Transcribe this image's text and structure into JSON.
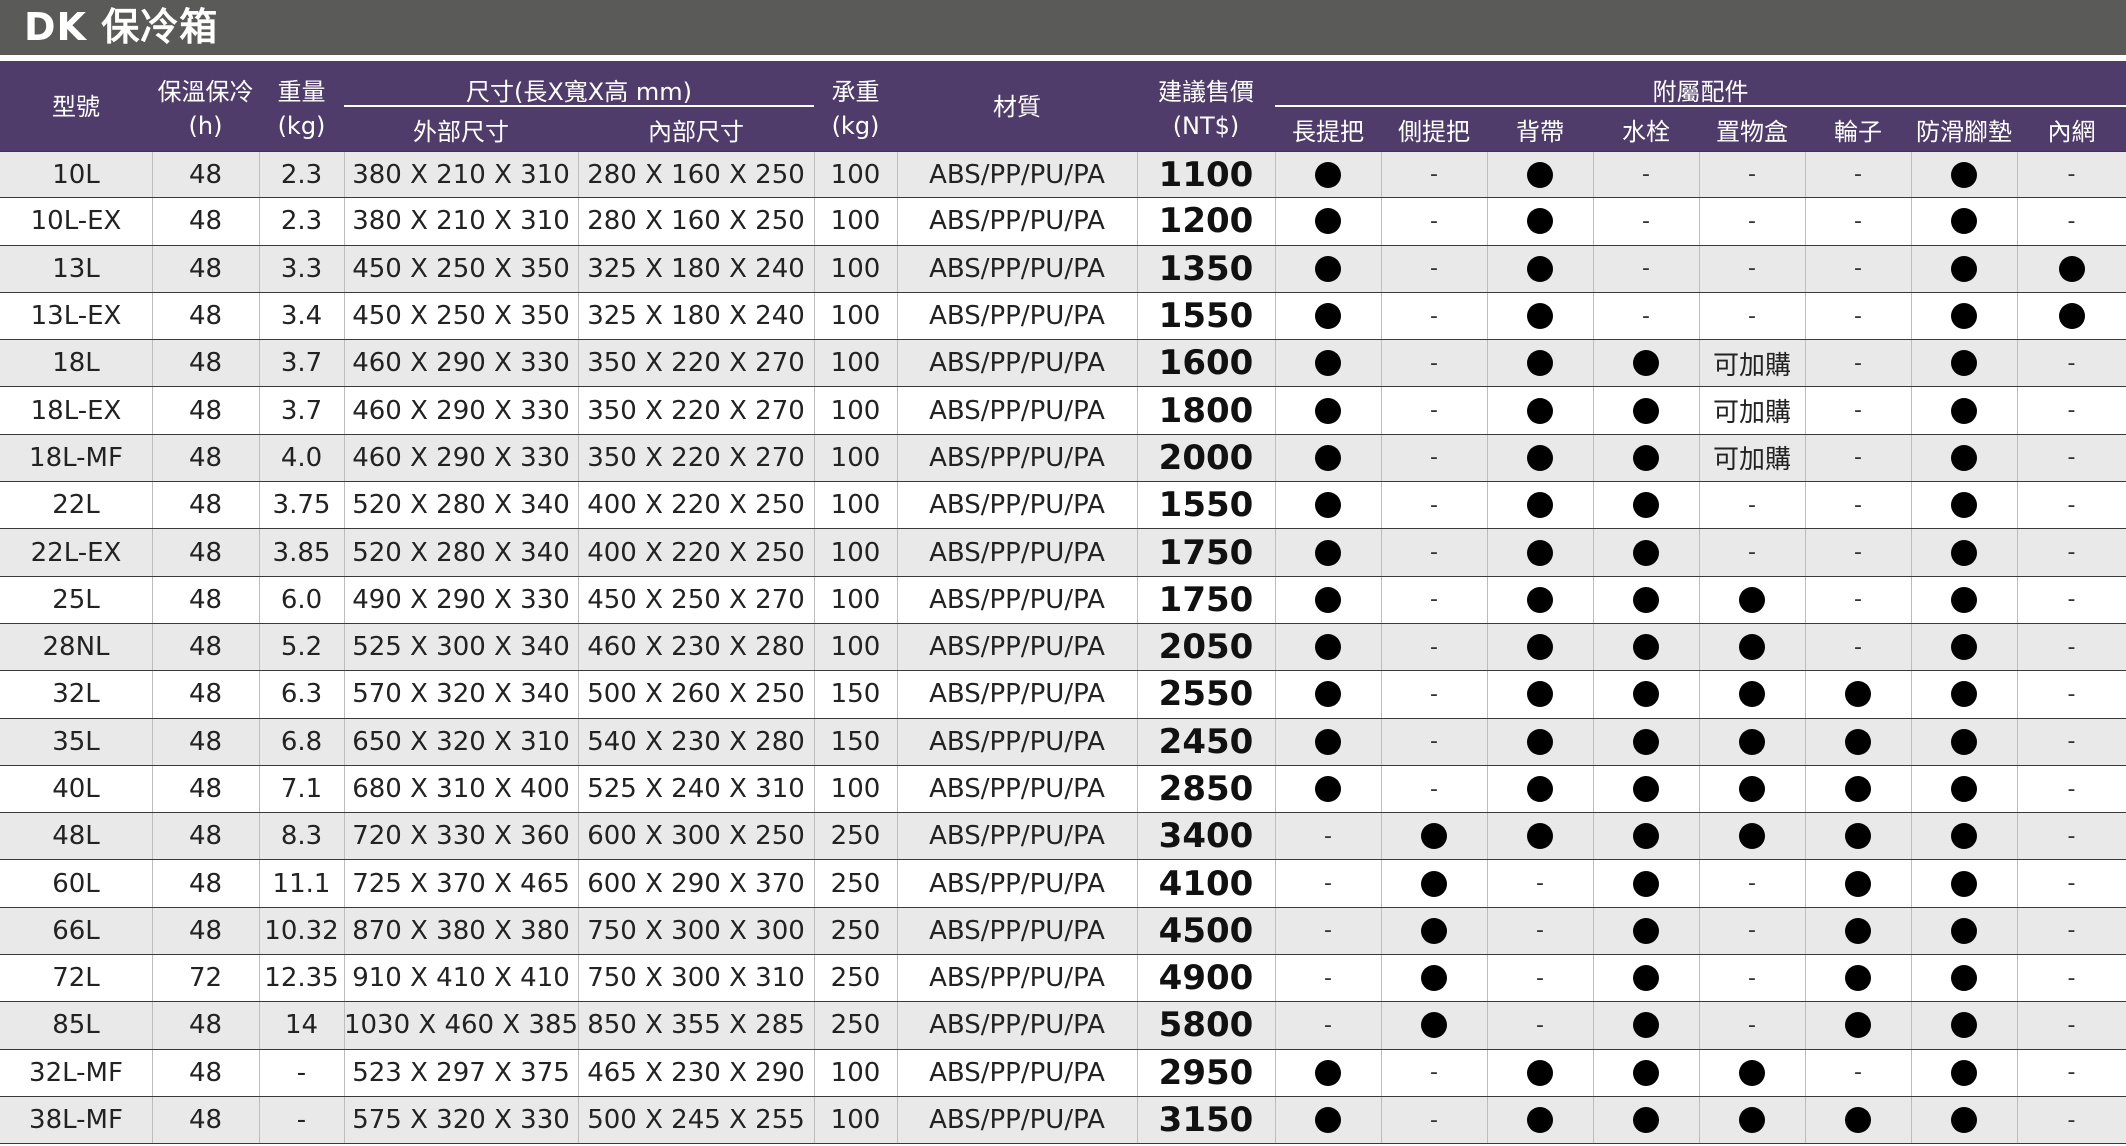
{
  "title": "DK 保冷箱",
  "header": {
    "model": "型號",
    "insulation": [
      "保溫保冷",
      "(h)"
    ],
    "weight": [
      "重量",
      "(kg)"
    ],
    "dims": "尺寸(長X寬X高 mm)",
    "outer": "外部尺寸",
    "inner": "內部尺寸",
    "load": [
      "承重",
      "(kg)"
    ],
    "material": "材質",
    "price": [
      "建議售價",
      "(NT$)"
    ],
    "accessories": "附屬配件",
    "acc_cols": [
      "長提把",
      "側提把",
      "背帶",
      "水栓",
      "置物盒",
      "輪子",
      "防滑腳墊",
      "內網"
    ]
  },
  "rows": [
    {
      "model": "10L",
      "hours": "48",
      "weight": "2.3",
      "outer": "380 X 210 X 310",
      "inner": "280 X 160 X 250",
      "load": "100",
      "material": "ABS/PP/PU/PA",
      "price": "1100",
      "acc": [
        "●",
        "-",
        "●",
        "-",
        "-",
        "-",
        "●",
        "-"
      ]
    },
    {
      "model": "10L-EX",
      "hours": "48",
      "weight": "2.3",
      "outer": "380 X 210 X 310",
      "inner": "280 X 160 X 250",
      "load": "100",
      "material": "ABS/PP/PU/PA",
      "price": "1200",
      "acc": [
        "●",
        "-",
        "●",
        "-",
        "-",
        "-",
        "●",
        "-"
      ]
    },
    {
      "model": "13L",
      "hours": "48",
      "weight": "3.3",
      "outer": "450 X 250 X 350",
      "inner": "325 X 180 X 240",
      "load": "100",
      "material": "ABS/PP/PU/PA",
      "price": "1350",
      "acc": [
        "●",
        "-",
        "●",
        "-",
        "-",
        "-",
        "●",
        "●"
      ]
    },
    {
      "model": "13L-EX",
      "hours": "48",
      "weight": "3.4",
      "outer": "450 X 250 X 350",
      "inner": "325 X 180 X 240",
      "load": "100",
      "material": "ABS/PP/PU/PA",
      "price": "1550",
      "acc": [
        "●",
        "-",
        "●",
        "-",
        "-",
        "-",
        "●",
        "●"
      ]
    },
    {
      "model": "18L",
      "hours": "48",
      "weight": "3.7",
      "outer": "460 X 290 X 330",
      "inner": "350 X 220 X 270",
      "load": "100",
      "material": "ABS/PP/PU/PA",
      "price": "1600",
      "acc": [
        "●",
        "-",
        "●",
        "●",
        "可加購",
        "-",
        "●",
        "-"
      ]
    },
    {
      "model": "18L-EX",
      "hours": "48",
      "weight": "3.7",
      "outer": "460 X 290 X 330",
      "inner": "350 X 220 X 270",
      "load": "100",
      "material": "ABS/PP/PU/PA",
      "price": "1800",
      "acc": [
        "●",
        "-",
        "●",
        "●",
        "可加購",
        "-",
        "●",
        "-"
      ]
    },
    {
      "model": "18L-MF",
      "hours": "48",
      "weight": "4.0",
      "outer": "460 X 290 X 330",
      "inner": "350 X 220 X 270",
      "load": "100",
      "material": "ABS/PP/PU/PA",
      "price": "2000",
      "acc": [
        "●",
        "-",
        "●",
        "●",
        "可加購",
        "-",
        "●",
        "-"
      ]
    },
    {
      "model": "22L",
      "hours": "48",
      "weight": "3.75",
      "outer": "520 X 280 X 340",
      "inner": "400 X 220 X 250",
      "load": "100",
      "material": "ABS/PP/PU/PA",
      "price": "1550",
      "acc": [
        "●",
        "-",
        "●",
        "●",
        "-",
        "-",
        "●",
        "-"
      ]
    },
    {
      "model": "22L-EX",
      "hours": "48",
      "weight": "3.85",
      "outer": "520 X 280 X 340",
      "inner": "400 X 220 X 250",
      "load": "100",
      "material": "ABS/PP/PU/PA",
      "price": "1750",
      "acc": [
        "●",
        "-",
        "●",
        "●",
        "-",
        "-",
        "●",
        "-"
      ]
    },
    {
      "model": "25L",
      "hours": "48",
      "weight": "6.0",
      "outer": "490 X 290 X 330",
      "inner": "450 X 250 X 270",
      "load": "100",
      "material": "ABS/PP/PU/PA",
      "price": "1750",
      "acc": [
        "●",
        "-",
        "●",
        "●",
        "●",
        "-",
        "●",
        "-"
      ]
    },
    {
      "model": "28NL",
      "hours": "48",
      "weight": "5.2",
      "outer": "525 X 300 X 340",
      "inner": "460 X 230 X 280",
      "load": "100",
      "material": "ABS/PP/PU/PA",
      "price": "2050",
      "acc": [
        "●",
        "-",
        "●",
        "●",
        "●",
        "-",
        "●",
        "-"
      ]
    },
    {
      "model": "32L",
      "hours": "48",
      "weight": "6.3",
      "outer": "570 X 320 X 340",
      "inner": "500 X 260 X 250",
      "load": "150",
      "material": "ABS/PP/PU/PA",
      "price": "2550",
      "acc": [
        "●",
        "-",
        "●",
        "●",
        "●",
        "●",
        "●",
        "-"
      ]
    },
    {
      "model": "35L",
      "hours": "48",
      "weight": "6.8",
      "outer": "650 X 320 X 310",
      "inner": "540 X 230 X 280",
      "load": "150",
      "material": "ABS/PP/PU/PA",
      "price": "2450",
      "acc": [
        "●",
        "-",
        "●",
        "●",
        "●",
        "●",
        "●",
        "-"
      ]
    },
    {
      "model": "40L",
      "hours": "48",
      "weight": "7.1",
      "outer": "680 X 310 X 400",
      "inner": "525 X 240 X 310",
      "load": "100",
      "material": "ABS/PP/PU/PA",
      "price": "2850",
      "acc": [
        "●",
        "-",
        "●",
        "●",
        "●",
        "●",
        "●",
        "-"
      ]
    },
    {
      "model": "48L",
      "hours": "48",
      "weight": "8.3",
      "outer": "720 X 330 X 360",
      "inner": "600 X 300 X 250",
      "load": "250",
      "material": "ABS/PP/PU/PA",
      "price": "3400",
      "acc": [
        "-",
        "●",
        "●",
        "●",
        "●",
        "●",
        "●",
        "-"
      ]
    },
    {
      "model": "60L",
      "hours": "48",
      "weight": "11.1",
      "outer": "725 X 370 X 465",
      "inner": "600 X 290 X 370",
      "load": "250",
      "material": "ABS/PP/PU/PA",
      "price": "4100",
      "acc": [
        "-",
        "●",
        "-",
        "●",
        "-",
        "●",
        "●",
        "-"
      ]
    },
    {
      "model": "66L",
      "hours": "48",
      "weight": "10.32",
      "outer": "870 X 380 X 380",
      "inner": "750 X 300 X 300",
      "load": "250",
      "material": "ABS/PP/PU/PA",
      "price": "4500",
      "acc": [
        "-",
        "●",
        "-",
        "●",
        "-",
        "●",
        "●",
        "-"
      ]
    },
    {
      "model": "72L",
      "hours": "72",
      "weight": "12.35",
      "outer": "910 X 410 X 410",
      "inner": "750 X 300 X 310",
      "load": "250",
      "material": "ABS/PP/PU/PA",
      "price": "4900",
      "acc": [
        "-",
        "●",
        "-",
        "●",
        "-",
        "●",
        "●",
        "-"
      ]
    },
    {
      "model": "85L",
      "hours": "48",
      "weight": "14",
      "outer": "1030 X 460 X 385",
      "inner": "850 X 355 X 285",
      "load": "250",
      "material": "ABS/PP/PU/PA",
      "price": "5800",
      "acc": [
        "-",
        "●",
        "-",
        "●",
        "-",
        "●",
        "●",
        "-"
      ]
    },
    {
      "model": "32L-MF",
      "hours": "48",
      "weight": "-",
      "outer": "523 X 297 X 375",
      "inner": "465 X 230 X 290",
      "load": "100",
      "material": "ABS/PP/PU/PA",
      "price": "2950",
      "acc": [
        "●",
        "-",
        "●",
        "●",
        "●",
        "-",
        "●",
        "-"
      ]
    },
    {
      "model": "38L-MF",
      "hours": "48",
      "weight": "-",
      "outer": "575 X 320 X 330",
      "inner": "500 X 245 X 255",
      "load": "100",
      "material": "ABS/PP/PU/PA",
      "price": "3150",
      "acc": [
        "●",
        "-",
        "●",
        "●",
        "●",
        "●",
        "●",
        "-"
      ]
    }
  ]
}
